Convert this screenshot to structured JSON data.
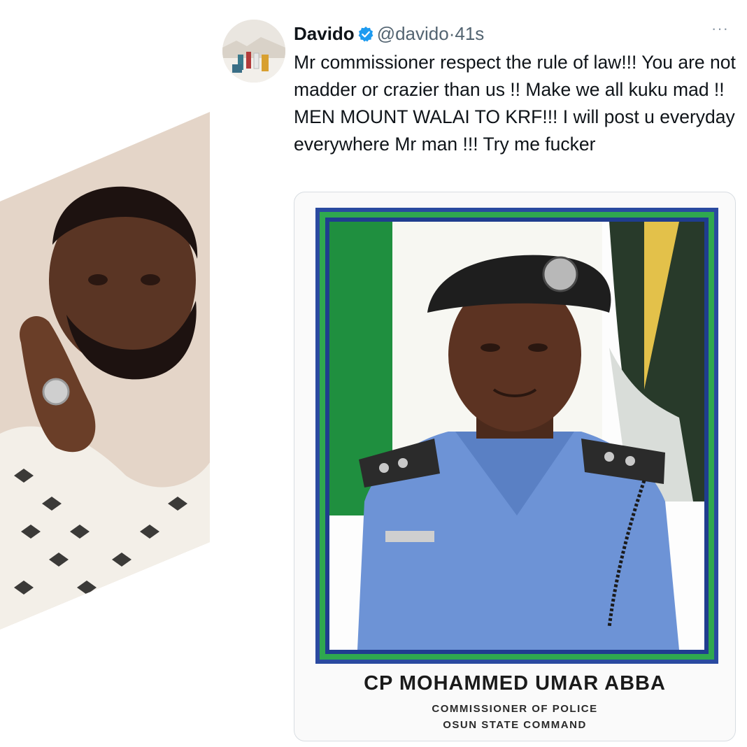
{
  "tweet": {
    "display_name": "Davido",
    "handle": "@davido",
    "separator": "·",
    "timestamp": "41s",
    "more_label": "···",
    "text": "Mr commissioner respect the rule of law!!! You are not madder or crazier than us !! Make we all kuku mad !! MEN MOUNT WALAI TO KRF!!! I will post u everyday everywhere Mr man !!! Try me fucker"
  },
  "media": {
    "caption_name": "CP MOHAMMED UMAR ABBA",
    "caption_title": "COMMISSIONER OF POLICE",
    "caption_command": "OSUN STATE COMMAND"
  },
  "colors": {
    "verified_blue": "#1d9bf0",
    "frame_green": "#2fa84f",
    "frame_blue": "#1f3d8f",
    "uniform_blue": "#6d93d6"
  },
  "icons": {
    "verified": "verified-badge-icon",
    "more": "more-options-icon"
  }
}
